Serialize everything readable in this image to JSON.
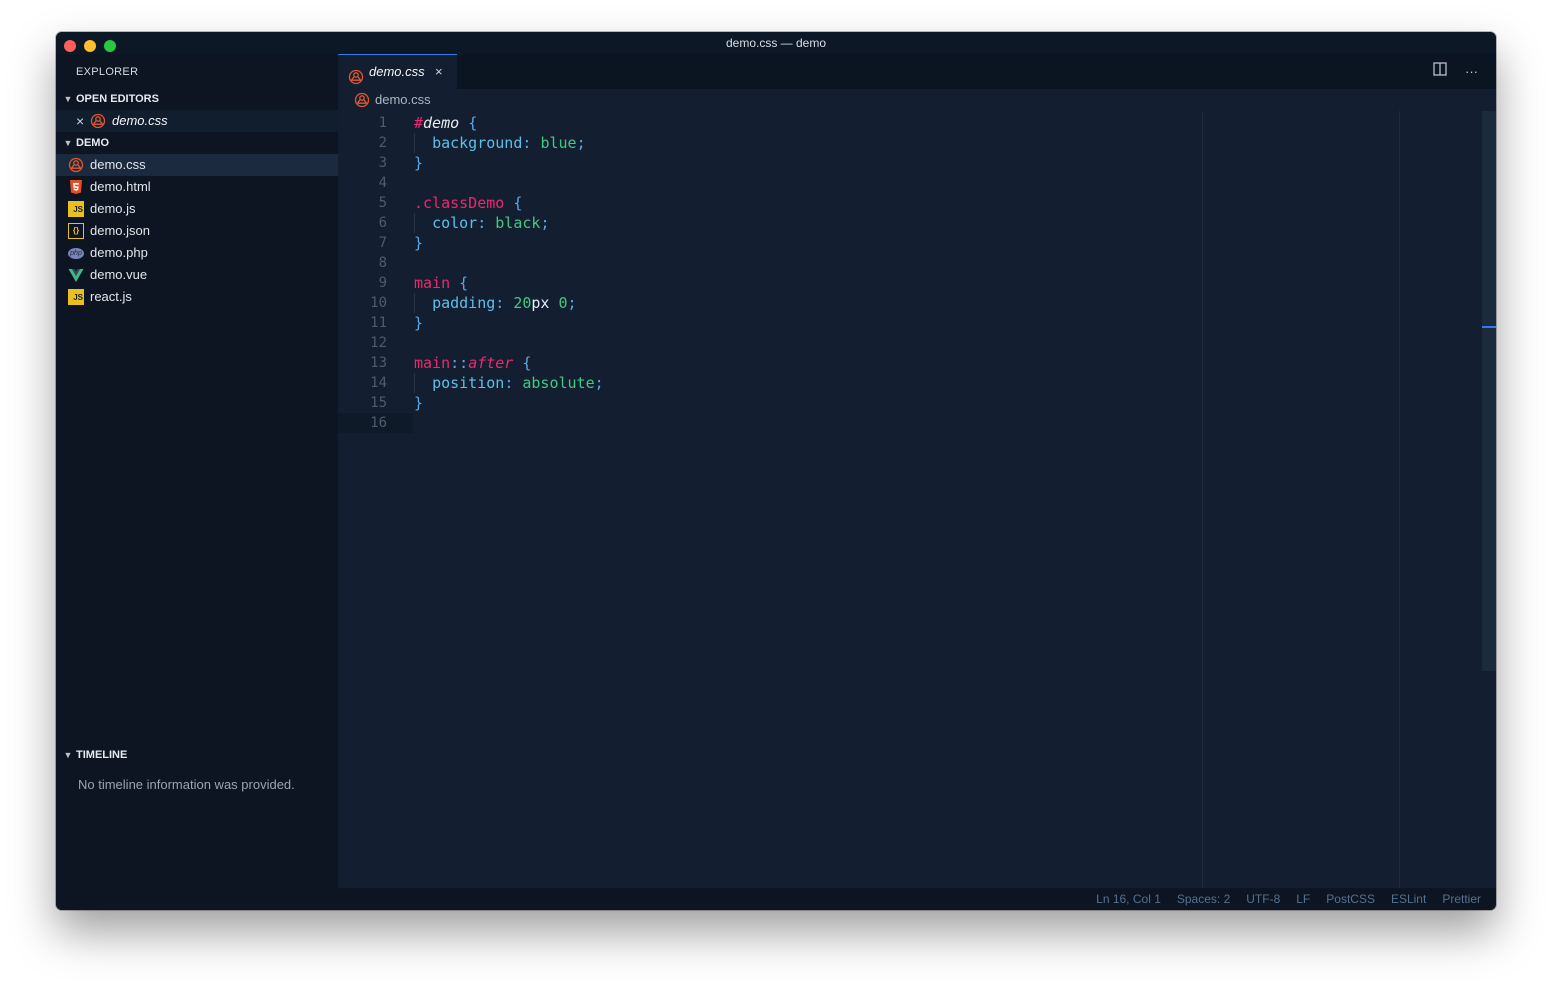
{
  "window": {
    "title": "demo.css — demo"
  },
  "sidebar": {
    "title": "EXPLORER",
    "open_editors": {
      "header": "OPEN EDITORS",
      "items": [
        {
          "label": "demo.css",
          "icon": "css-icon",
          "close": "×"
        }
      ]
    },
    "project": {
      "header": "DEMO",
      "files": [
        {
          "label": "demo.css",
          "icon": "css-icon",
          "active": true
        },
        {
          "label": "demo.html",
          "icon": "html5-icon"
        },
        {
          "label": "demo.js",
          "icon": "js-icon",
          "badge": "JS"
        },
        {
          "label": "demo.json",
          "icon": "json-icon",
          "badge": "{}"
        },
        {
          "label": "demo.php",
          "icon": "php-icon",
          "badge": "php"
        },
        {
          "label": "demo.vue",
          "icon": "vue-icon"
        },
        {
          "label": "react.js",
          "icon": "js-icon",
          "badge": "JS"
        }
      ]
    },
    "timeline": {
      "header": "TIMELINE",
      "empty_text": "No timeline information was provided."
    }
  },
  "tab": {
    "label": "demo.css",
    "icon": "css-icon",
    "close": "×"
  },
  "tab_actions": {
    "split_icon": "split-editor-icon",
    "more": "···"
  },
  "breadcrumb": {
    "label": "demo.css",
    "icon": "css-icon"
  },
  "editor": {
    "current_line": 16,
    "lines": [
      {
        "n": "1",
        "tokens": [
          {
            "t": "#",
            "c": "#f0266f"
          },
          {
            "t": "demo",
            "c": "#e8ecf1",
            "i": true
          },
          {
            "t": " ",
            "c": "#d4dce6"
          },
          {
            "t": "{",
            "c": "#5ca7e8"
          }
        ]
      },
      {
        "n": "2",
        "guide": true,
        "tokens": [
          {
            "t": "  ",
            "c": "#d4dce6"
          },
          {
            "t": "background",
            "c": "#5cc0ec"
          },
          {
            "t": ": ",
            "c": "#5ca7e8"
          },
          {
            "t": "blue",
            "c": "#3fca83"
          },
          {
            "t": ";",
            "c": "#5ca7e8"
          }
        ]
      },
      {
        "n": "3",
        "tokens": [
          {
            "t": "}",
            "c": "#5ca7e8"
          }
        ]
      },
      {
        "n": "4",
        "tokens": []
      },
      {
        "n": "5",
        "tokens": [
          {
            "t": ".classDemo",
            "c": "#f0266f"
          },
          {
            "t": " ",
            "c": "#d4dce6"
          },
          {
            "t": "{",
            "c": "#5ca7e8"
          }
        ]
      },
      {
        "n": "6",
        "guide": true,
        "tokens": [
          {
            "t": "  ",
            "c": "#d4dce6"
          },
          {
            "t": "color",
            "c": "#5cc0ec"
          },
          {
            "t": ": ",
            "c": "#5ca7e8"
          },
          {
            "t": "black",
            "c": "#3fca83"
          },
          {
            "t": ";",
            "c": "#5ca7e8"
          }
        ]
      },
      {
        "n": "7",
        "tokens": [
          {
            "t": "}",
            "c": "#5ca7e8"
          }
        ]
      },
      {
        "n": "8",
        "tokens": []
      },
      {
        "n": "9",
        "tokens": [
          {
            "t": "main",
            "c": "#f0266f"
          },
          {
            "t": " ",
            "c": "#d4dce6"
          },
          {
            "t": "{",
            "c": "#5ca7e8"
          }
        ]
      },
      {
        "n": "10",
        "guide": true,
        "tokens": [
          {
            "t": "  ",
            "c": "#d4dce6"
          },
          {
            "t": "padding",
            "c": "#5cc0ec"
          },
          {
            "t": ": ",
            "c": "#5ca7e8"
          },
          {
            "t": "20",
            "c": "#3fca83"
          },
          {
            "t": "px",
            "c": "#e8ecf1"
          },
          {
            "t": " ",
            "c": "#d4dce6"
          },
          {
            "t": "0",
            "c": "#3fca83"
          },
          {
            "t": ";",
            "c": "#5ca7e8"
          }
        ]
      },
      {
        "n": "11",
        "tokens": [
          {
            "t": "}",
            "c": "#5ca7e8"
          }
        ]
      },
      {
        "n": "12",
        "tokens": []
      },
      {
        "n": "13",
        "tokens": [
          {
            "t": "main",
            "c": "#f0266f"
          },
          {
            "t": "::",
            "c": "#5ca7e8"
          },
          {
            "t": "after",
            "c": "#f0266f",
            "i": true
          },
          {
            "t": " ",
            "c": "#d4dce6"
          },
          {
            "t": "{",
            "c": "#5ca7e8"
          }
        ]
      },
      {
        "n": "14",
        "guide": true,
        "tokens": [
          {
            "t": "  ",
            "c": "#d4dce6"
          },
          {
            "t": "position",
            "c": "#5cc0ec"
          },
          {
            "t": ": ",
            "c": "#5ca7e8"
          },
          {
            "t": "absolute",
            "c": "#3fca83"
          },
          {
            "t": ";",
            "c": "#5ca7e8"
          }
        ]
      },
      {
        "n": "15",
        "tokens": [
          {
            "t": "}",
            "c": "#5ca7e8"
          }
        ]
      },
      {
        "n": "16",
        "tokens": []
      }
    ]
  },
  "statusbar": {
    "items": [
      "Ln 16, Col 1",
      "Spaces: 2",
      "UTF-8",
      "LF",
      "PostCSS",
      "ESLint",
      "Prettier"
    ]
  },
  "colors": {
    "traffic_close": "#fe5f57",
    "traffic_minimize": "#febc2e",
    "traffic_zoom": "#28c840",
    "css_icon": "#e4572e",
    "html5_icon": "#e44d26",
    "vue_green": "#41b883",
    "vue_dark": "#35495e",
    "tab_accent": "#2d7ee6"
  }
}
